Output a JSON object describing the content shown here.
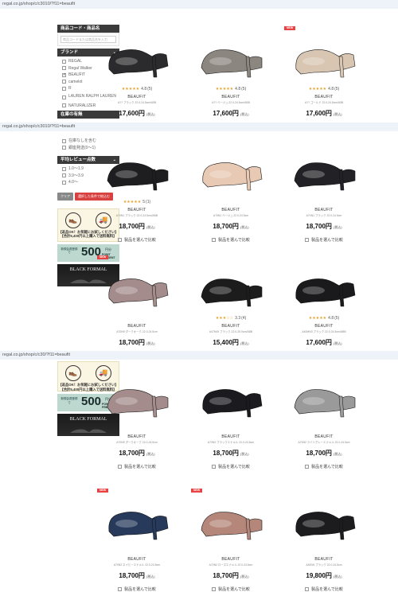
{
  "urls": [
    "regal.co.jp/shop/c/c3010/?f11=beaufit",
    "regal.co.jp/shop/c/c3010/?f11=beaufit",
    "regal.co.jp/shop/c/c30/?f11=beaufit"
  ],
  "sidebar": {
    "code_header": "商品コード・商品名",
    "code_placeholder": "商品コードまたは商品名を入力",
    "brand_header": "ブランド",
    "brands": [
      {
        "label": "REGAL",
        "checked": false
      },
      {
        "label": "Regal Walker",
        "checked": false
      },
      {
        "label": "BEAUFIT",
        "checked": true
      },
      {
        "label": "camelot",
        "checked": false
      },
      {
        "label": "R",
        "checked": false
      },
      {
        "label": "LAUREN RALPH LAUREN",
        "checked": false
      },
      {
        "label": "NATURALIZER",
        "checked": false
      }
    ],
    "collapsed_label": "在庫の有無",
    "stock_items": [
      {
        "label": "在庫なしを含む",
        "checked": false
      },
      {
        "label": "銀座発送(0〜1)",
        "checked": false
      }
    ],
    "review_header": "平均レビュー点数",
    "review_items": [
      "1.0〜1.9",
      "3.9〜3.9",
      "4.0〜"
    ],
    "clear_label": "クリア",
    "search_label": "選択した条件で絞込む",
    "banner_ship_text": "【返品OK！お気軽にお試しください】",
    "banner_ship_sub": "【合計5,400円以上購入で送料無料】",
    "banner_point_left": "新規会員登録で",
    "banner_point_num": "500",
    "banner_point_unit": "円分",
    "banner_point_sub": "POINT PRESENT",
    "banner_formal": "BLACK FORMAL"
  },
  "common": {
    "brand": "BEAUFIT",
    "tax": "(税込)",
    "compare": "製品を選んで比較",
    "star_icon": "star-icon"
  },
  "products": [
    {
      "sku": "A??  ブラック 22.0-24.5cm/ABB",
      "price": "17,600円",
      "stars": "★★★★★",
      "rating": "4.8",
      "count": "(5)",
      "new": false,
      "color": "#2b2b2d"
    },
    {
      "sku": "A??  ベージュ 22.0-24.5cm/ABB",
      "price": "17,600円",
      "stars": "★★★★★",
      "rating": "4.8",
      "count": "(5)",
      "new": false,
      "color": "#8c8680"
    },
    {
      "sku": "A??  ゴールド 22.0-24.5cm/ABB",
      "price": "17,600円",
      "stars": "★★★★★",
      "rating": "4.8",
      "count": "(5)",
      "new": true,
      "color": "#d9c6b2"
    },
    {
      "sku": "A70N1  ブラック 22.0-24.5cm/ABB",
      "price": "18,700円",
      "stars": "★★★★★",
      "rating": "5",
      "count": "(1)",
      "new": false,
      "color": "#1e1e20"
    },
    {
      "sku": "A70N1  ベージュ 22.0-24.5cm",
      "price": "18,700円",
      "stars": "",
      "rating": "",
      "count": "",
      "new": false,
      "color": "#e8c9b4"
    },
    {
      "sku": "A70N1  ブラック 22.0-24.5cm",
      "price": "18,700円",
      "stars": "",
      "rating": "",
      "count": "",
      "new": false,
      "color": "#222226"
    },
    {
      "sku": "A70N9  ダークオーク 22.0-24.5cm",
      "price": "18,700円",
      "stars": "",
      "rating": "",
      "count": "",
      "new": true,
      "color": "#a58c8c"
    },
    {
      "sku": "A47N49  ブラック 22.0-25.0cm/ABB",
      "price": "15,400円",
      "stars": "★★★☆☆",
      "rating": "3.3",
      "count": "(4)",
      "new": false,
      "color": "#1c1c1c"
    },
    {
      "sku": "A40MN3  ブラック 22.0-24.5cm/ABB",
      "price": "17,600円",
      "stars": "★★★★★",
      "rating": "4.8",
      "count": "(5)",
      "new": false,
      "color": "#1a1a1c"
    },
    {
      "sku": "A70N9  ダークオーク 22.0-24.5cm",
      "price": "18,700円",
      "stars": "",
      "rating": "",
      "count": "",
      "new": false,
      "color": "#a58c8c"
    },
    {
      "sku": "A70N2  ブラックエナメル 22.0-24.5cm",
      "price": "18,700円",
      "stars": "",
      "rating": "",
      "count": "",
      "new": false,
      "color": "#1a1a1f"
    },
    {
      "sku": "A70N2  ライトグレーエナメル 22.0-24.5cm",
      "price": "18,700円",
      "stars": "",
      "rating": "",
      "count": "",
      "new": false,
      "color": "#9a9a9a"
    },
    {
      "sku": "A70N2  ネイビーエナメル 22.0-24.5cm",
      "price": "18,700円",
      "stars": "",
      "rating": "",
      "count": "",
      "new": true,
      "color": "#273a5c"
    },
    {
      "sku": "A70N2  ローズエナメル 22.0-24.5cm",
      "price": "18,700円",
      "stars": "",
      "rating": "",
      "count": "",
      "new": true,
      "color": "#b4877a"
    },
    {
      "sku": "A40NH  ブラック 22.0-24.5cm",
      "price": "19,800円",
      "stars": "",
      "rating": "",
      "count": "",
      "new": false,
      "color": "#1c1c1f"
    }
  ],
  "colors": {
    "accent": "#d94040",
    "sidebar_header": "#3a3a3a",
    "star": "#e5a22a"
  }
}
